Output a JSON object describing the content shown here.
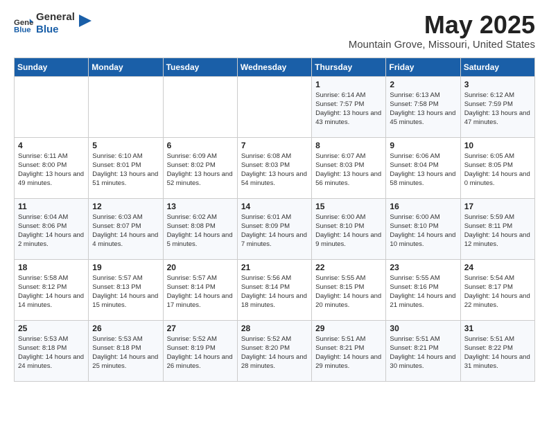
{
  "logo": {
    "general": "General",
    "blue": "Blue"
  },
  "header": {
    "title": "May 2025",
    "subtitle": "Mountain Grove, Missouri, United States"
  },
  "days": [
    "Sunday",
    "Monday",
    "Tuesday",
    "Wednesday",
    "Thursday",
    "Friday",
    "Saturday"
  ],
  "weeks": [
    [
      {
        "date": "",
        "info": ""
      },
      {
        "date": "",
        "info": ""
      },
      {
        "date": "",
        "info": ""
      },
      {
        "date": "",
        "info": ""
      },
      {
        "date": "1",
        "sunrise": "6:14 AM",
        "sunset": "7:57 PM",
        "daylight": "13 hours and 43 minutes."
      },
      {
        "date": "2",
        "sunrise": "6:13 AM",
        "sunset": "7:58 PM",
        "daylight": "13 hours and 45 minutes."
      },
      {
        "date": "3",
        "sunrise": "6:12 AM",
        "sunset": "7:59 PM",
        "daylight": "13 hours and 47 minutes."
      }
    ],
    [
      {
        "date": "4",
        "sunrise": "6:11 AM",
        "sunset": "8:00 PM",
        "daylight": "13 hours and 49 minutes."
      },
      {
        "date": "5",
        "sunrise": "6:10 AM",
        "sunset": "8:01 PM",
        "daylight": "13 hours and 51 minutes."
      },
      {
        "date": "6",
        "sunrise": "6:09 AM",
        "sunset": "8:02 PM",
        "daylight": "13 hours and 52 minutes."
      },
      {
        "date": "7",
        "sunrise": "6:08 AM",
        "sunset": "8:03 PM",
        "daylight": "13 hours and 54 minutes."
      },
      {
        "date": "8",
        "sunrise": "6:07 AM",
        "sunset": "8:03 PM",
        "daylight": "13 hours and 56 minutes."
      },
      {
        "date": "9",
        "sunrise": "6:06 AM",
        "sunset": "8:04 PM",
        "daylight": "13 hours and 58 minutes."
      },
      {
        "date": "10",
        "sunrise": "6:05 AM",
        "sunset": "8:05 PM",
        "daylight": "14 hours and 0 minutes."
      }
    ],
    [
      {
        "date": "11",
        "sunrise": "6:04 AM",
        "sunset": "8:06 PM",
        "daylight": "14 hours and 2 minutes."
      },
      {
        "date": "12",
        "sunrise": "6:03 AM",
        "sunset": "8:07 PM",
        "daylight": "14 hours and 4 minutes."
      },
      {
        "date": "13",
        "sunrise": "6:02 AM",
        "sunset": "8:08 PM",
        "daylight": "14 hours and 5 minutes."
      },
      {
        "date": "14",
        "sunrise": "6:01 AM",
        "sunset": "8:09 PM",
        "daylight": "14 hours and 7 minutes."
      },
      {
        "date": "15",
        "sunrise": "6:00 AM",
        "sunset": "8:10 PM",
        "daylight": "14 hours and 9 minutes."
      },
      {
        "date": "16",
        "sunrise": "6:00 AM",
        "sunset": "8:10 PM",
        "daylight": "14 hours and 10 minutes."
      },
      {
        "date": "17",
        "sunrise": "5:59 AM",
        "sunset": "8:11 PM",
        "daylight": "14 hours and 12 minutes."
      }
    ],
    [
      {
        "date": "18",
        "sunrise": "5:58 AM",
        "sunset": "8:12 PM",
        "daylight": "14 hours and 14 minutes."
      },
      {
        "date": "19",
        "sunrise": "5:57 AM",
        "sunset": "8:13 PM",
        "daylight": "14 hours and 15 minutes."
      },
      {
        "date": "20",
        "sunrise": "5:57 AM",
        "sunset": "8:14 PM",
        "daylight": "14 hours and 17 minutes."
      },
      {
        "date": "21",
        "sunrise": "5:56 AM",
        "sunset": "8:14 PM",
        "daylight": "14 hours and 18 minutes."
      },
      {
        "date": "22",
        "sunrise": "5:55 AM",
        "sunset": "8:15 PM",
        "daylight": "14 hours and 20 minutes."
      },
      {
        "date": "23",
        "sunrise": "5:55 AM",
        "sunset": "8:16 PM",
        "daylight": "14 hours and 21 minutes."
      },
      {
        "date": "24",
        "sunrise": "5:54 AM",
        "sunset": "8:17 PM",
        "daylight": "14 hours and 22 minutes."
      }
    ],
    [
      {
        "date": "25",
        "sunrise": "5:53 AM",
        "sunset": "8:18 PM",
        "daylight": "14 hours and 24 minutes."
      },
      {
        "date": "26",
        "sunrise": "5:53 AM",
        "sunset": "8:18 PM",
        "daylight": "14 hours and 25 minutes."
      },
      {
        "date": "27",
        "sunrise": "5:52 AM",
        "sunset": "8:19 PM",
        "daylight": "14 hours and 26 minutes."
      },
      {
        "date": "28",
        "sunrise": "5:52 AM",
        "sunset": "8:20 PM",
        "daylight": "14 hours and 28 minutes."
      },
      {
        "date": "29",
        "sunrise": "5:51 AM",
        "sunset": "8:21 PM",
        "daylight": "14 hours and 29 minutes."
      },
      {
        "date": "30",
        "sunrise": "5:51 AM",
        "sunset": "8:21 PM",
        "daylight": "14 hours and 30 minutes."
      },
      {
        "date": "31",
        "sunrise": "5:51 AM",
        "sunset": "8:22 PM",
        "daylight": "14 hours and 31 minutes."
      }
    ]
  ],
  "labels": {
    "sunrise": "Sunrise:",
    "sunset": "Sunset:",
    "daylight": "Daylight:"
  }
}
